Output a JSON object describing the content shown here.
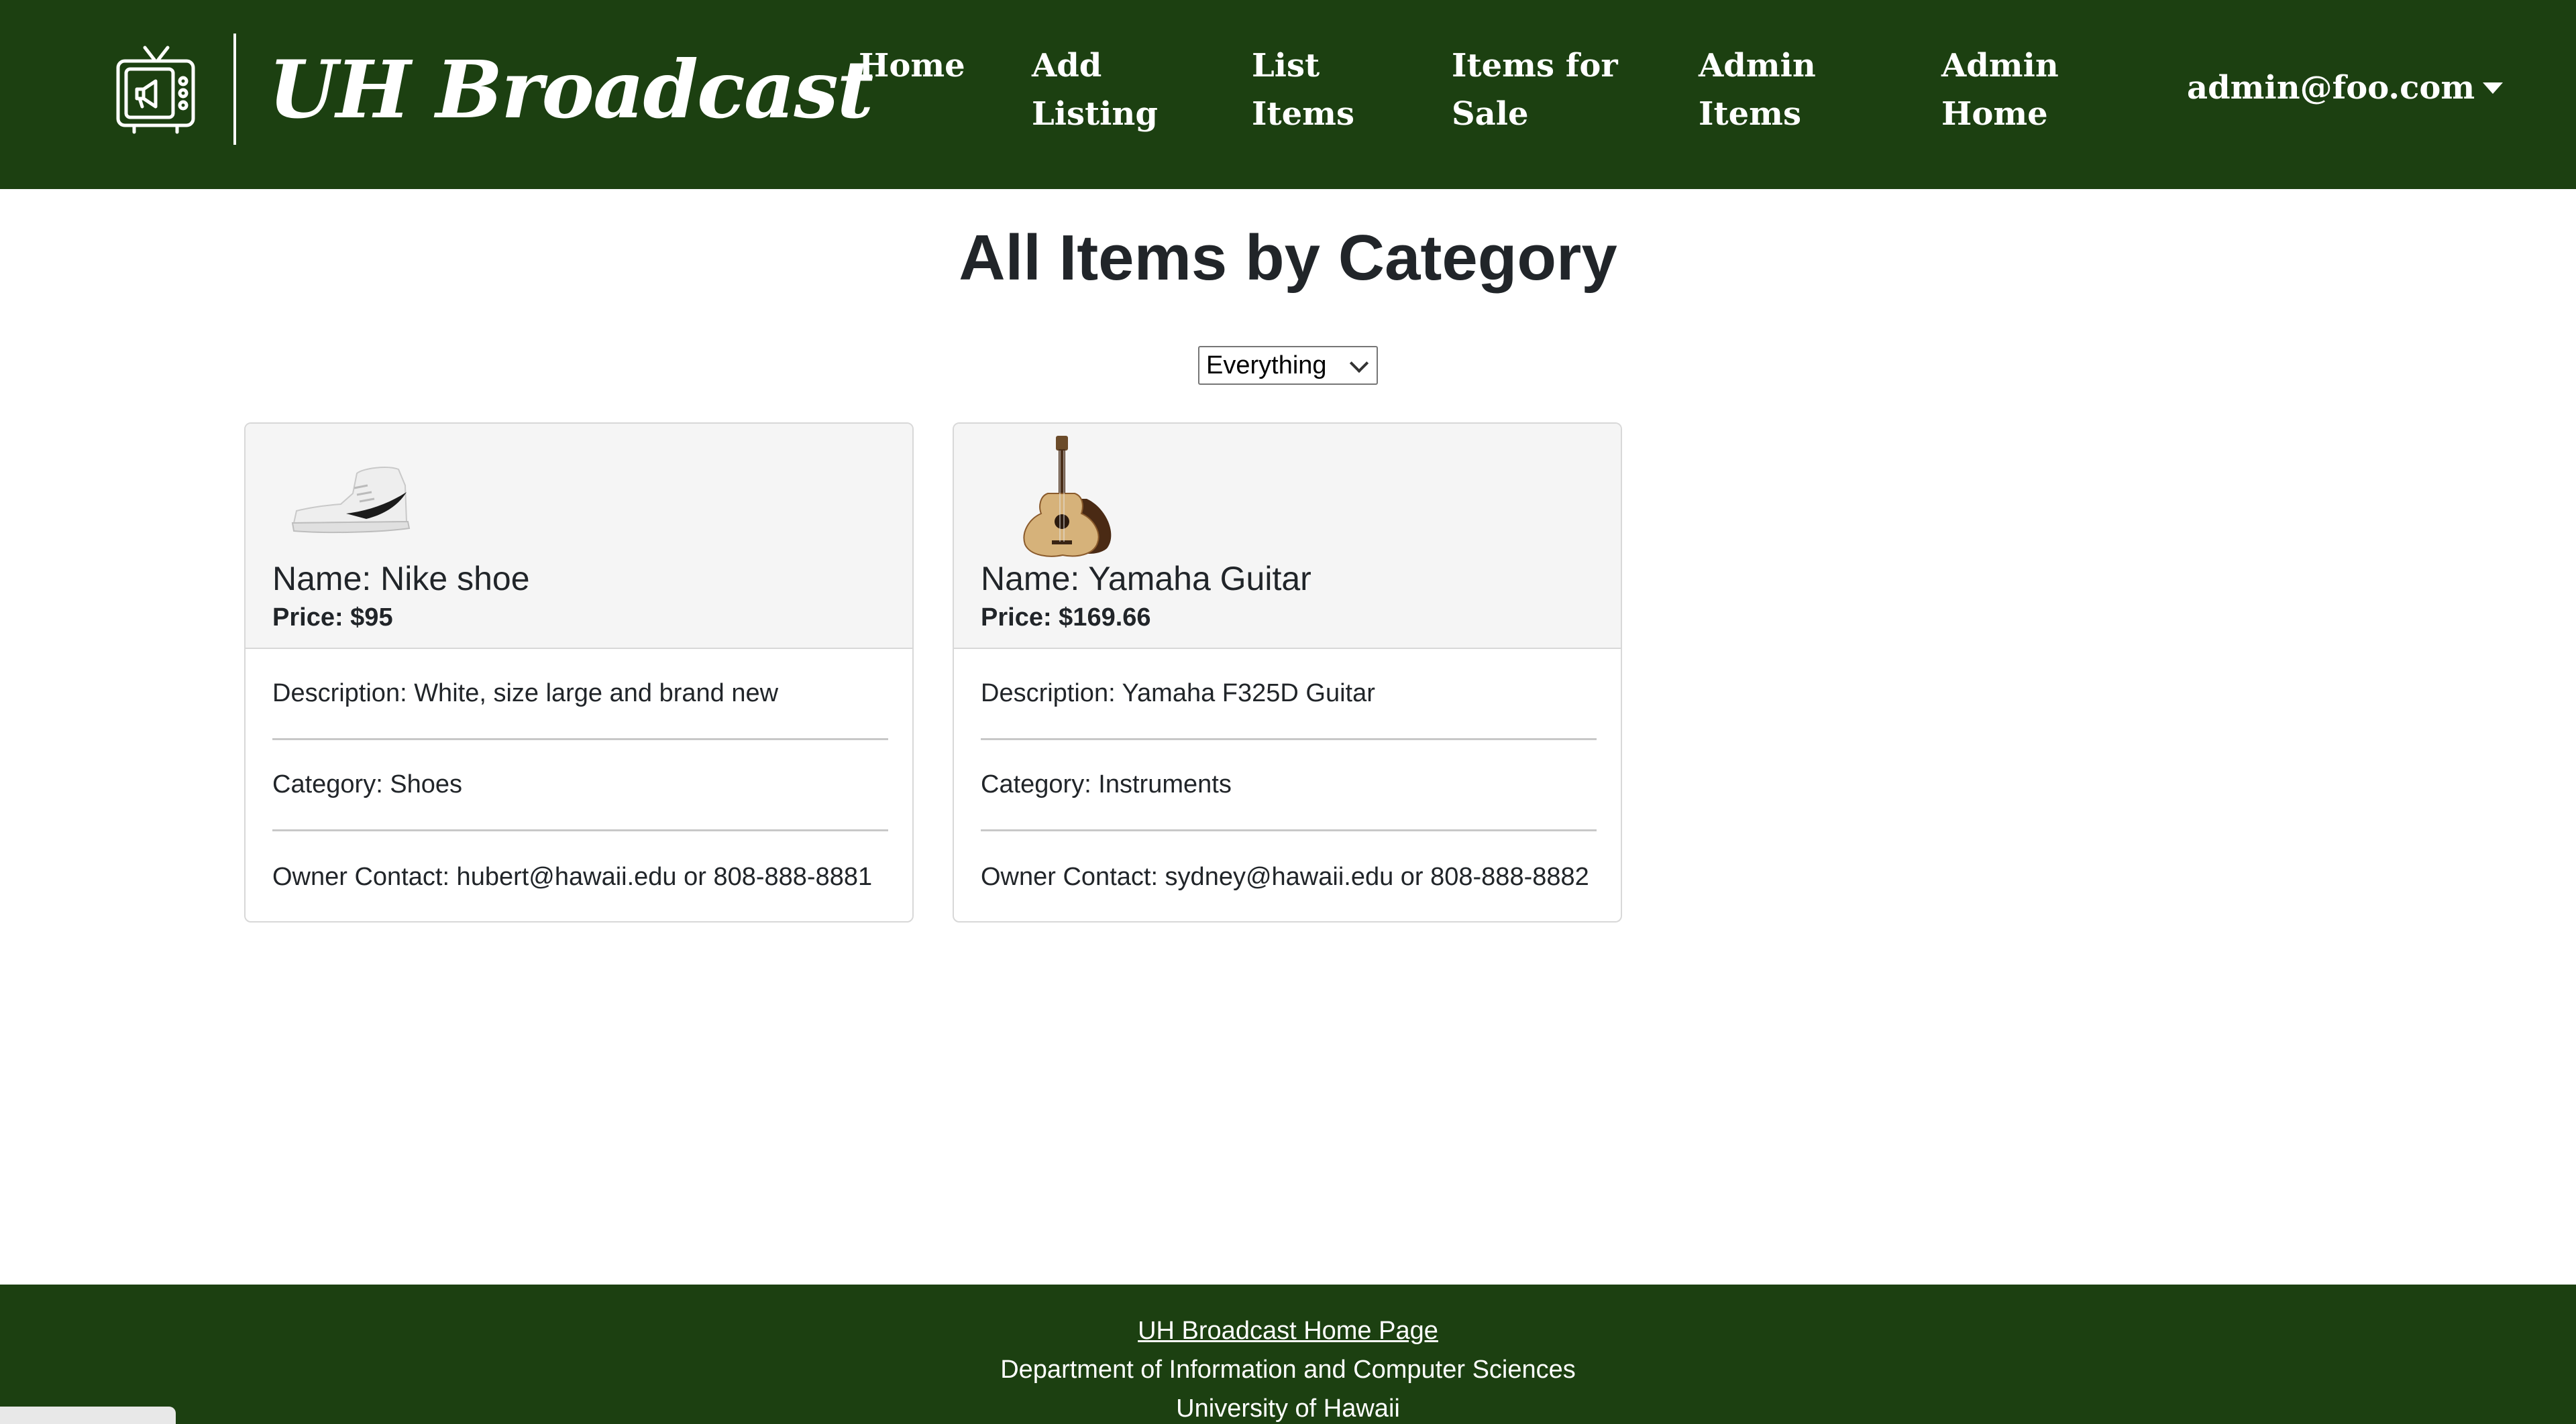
{
  "navbar": {
    "brand_title": "UH Broadcast",
    "logo_icon": "tv-megaphone-icon",
    "links": [
      "Home",
      "Add Listing",
      "List Items",
      "Items for Sale",
      "Admin Items",
      "Admin Home"
    ],
    "user_email": "admin@foo.com",
    "background_color": "#1c4011"
  },
  "main": {
    "title": "All Items by Category",
    "category_select": {
      "selected": "Everything"
    },
    "cards": [
      {
        "image_icon": "sneaker-image",
        "name": "Name: Nike shoe",
        "price": "Price: $95",
        "description": "Description: White, size large and brand new",
        "category": "Category: Shoes",
        "contact": "Owner Contact: hubert@hawaii.edu or 808-888-8881"
      },
      {
        "image_icon": "guitar-image",
        "name": "Name: Yamaha Guitar",
        "price": "Price: $169.66",
        "description": "Description: Yamaha F325D Guitar",
        "category": "Category: Instruments",
        "contact": "Owner Contact: sydney@hawaii.edu or 808-888-8882"
      }
    ]
  },
  "footer": {
    "home_link": "UH Broadcast Home Page",
    "line1": "Department of Information and Computer Sciences",
    "line2": "University of Hawaii"
  }
}
